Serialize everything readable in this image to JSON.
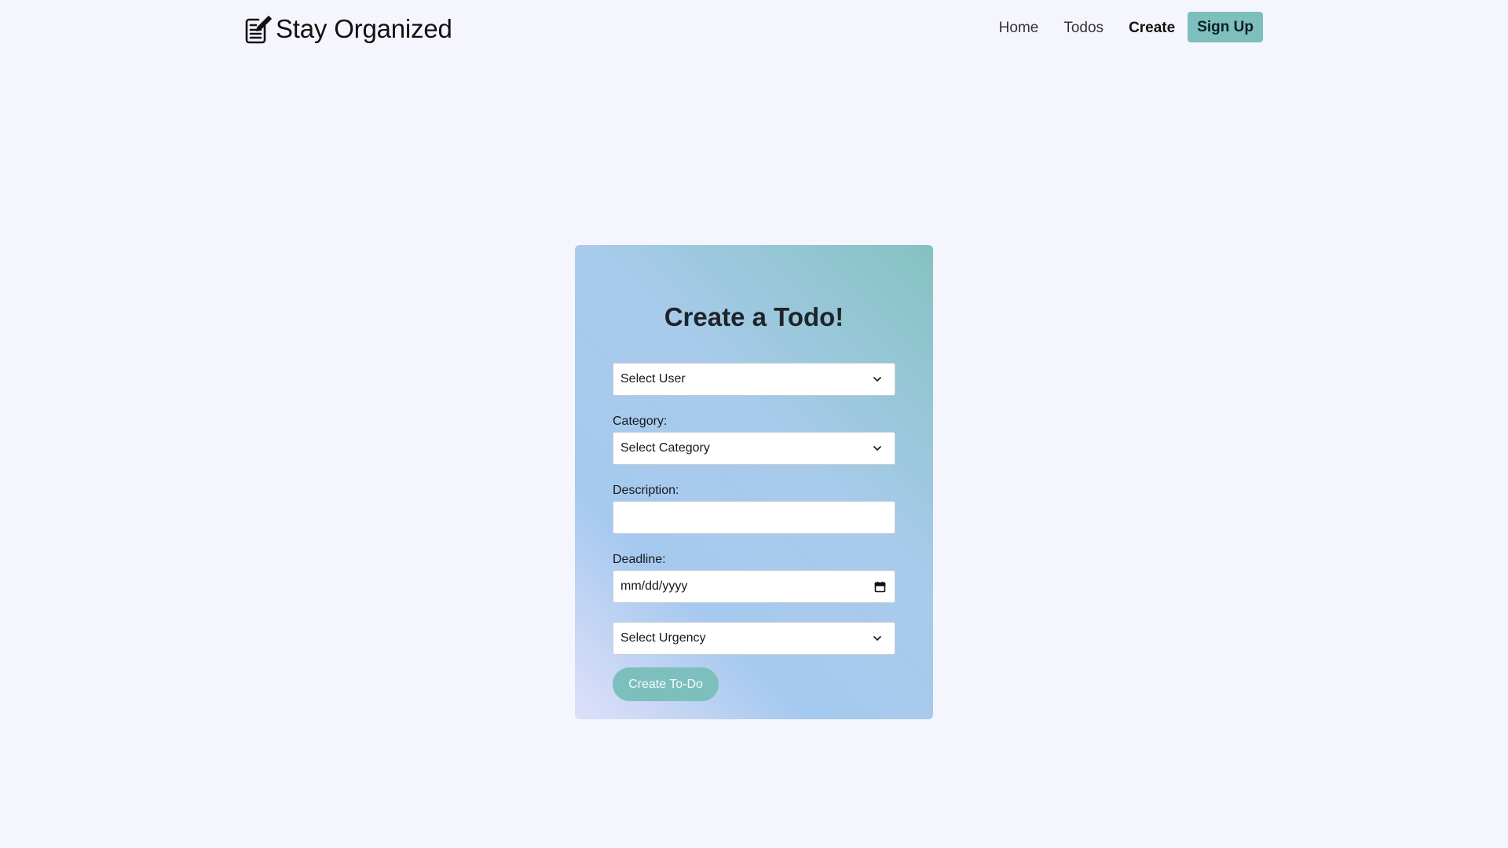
{
  "nav": {
    "brand": "Stay Organized",
    "brand_icon": "notepad-edit-icon",
    "links": {
      "home": "Home",
      "todos": "Todos",
      "create": "Create"
    },
    "signup": "Sign Up"
  },
  "form": {
    "title": "Create a Todo!",
    "user_select": "Select User",
    "category_label": "Category:",
    "category_select": "Select Category",
    "description_label": "Description:",
    "description_value": "",
    "deadline_label": "Deadline:",
    "deadline_placeholder": "mm/dd/yyyy",
    "urgency_select": "Select Urgency",
    "submit": "Create To-Do"
  },
  "colors": {
    "accent": "#7dbfbd",
    "background": "#f5f5fd"
  }
}
